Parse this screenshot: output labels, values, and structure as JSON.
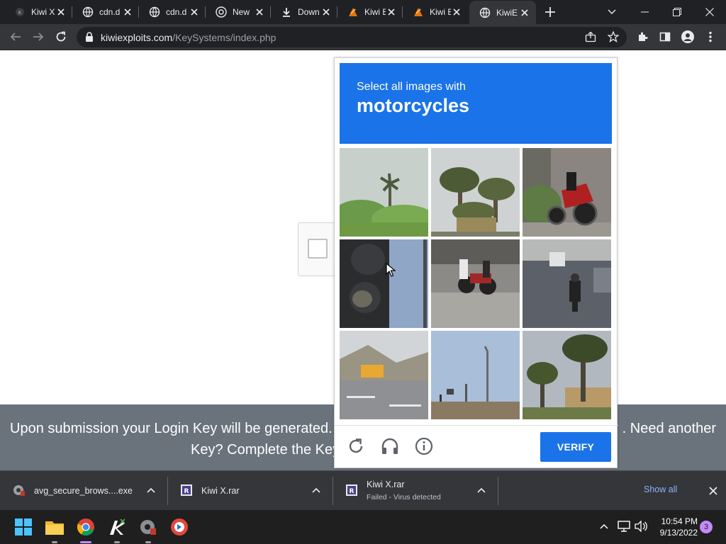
{
  "browser": {
    "tabs": [
      {
        "title": "Kiwi X",
        "icon": "kiwi-favicon"
      },
      {
        "title": "cdn.d",
        "icon": "globe-icon"
      },
      {
        "title": "cdn.d",
        "icon": "globe-icon"
      },
      {
        "title": "New",
        "icon": "chrome-icon"
      },
      {
        "title": "Down",
        "icon": "download-icon"
      },
      {
        "title": "Kiwi E",
        "icon": "kiwi-favicon"
      },
      {
        "title": "Kiwi E",
        "icon": "kiwi-favicon"
      },
      {
        "title": "KiwiE",
        "icon": "globe-icon",
        "active": true
      }
    ],
    "url_domain": "kiwiexploits.com",
    "url_path": "/KeySystems/index.php"
  },
  "page": {
    "banner_line1": "Upon submission your Login Key will be generated. Need another",
    "banner_line1_left": "Upon submission your Login Key will be generated.",
    "banner_line1_right": ". Need another",
    "banner_line2_left": "Key? Complete the Key"
  },
  "captcha": {
    "instruction": "Select all images with",
    "target": "motorcycles",
    "verify_label": "VERIFY",
    "tiles": [
      "palm-tree-bushes",
      "palm-trees-sign",
      "red-motorcycle",
      "traffic-light",
      "motorcycles-parked",
      "motorcyclist-road",
      "school-bus-street",
      "street-lights",
      "palm-trees-houses"
    ]
  },
  "downloads": {
    "items": [
      {
        "name": "avg_secure_brows....exe",
        "status": ""
      },
      {
        "name": "Kiwi X.rar",
        "status": ""
      },
      {
        "name": "Kiwi X.rar",
        "status": "Failed - Virus detected"
      }
    ],
    "show_all": "Show all"
  },
  "taskbar": {
    "time": "10:54 PM",
    "date": "9/13/2022",
    "notifications": "3"
  },
  "colors": {
    "captcha_blue": "#1a73e8",
    "banner_gray": "#6a737b",
    "chrome_dark": "#202124",
    "toolbar": "#35363a"
  }
}
